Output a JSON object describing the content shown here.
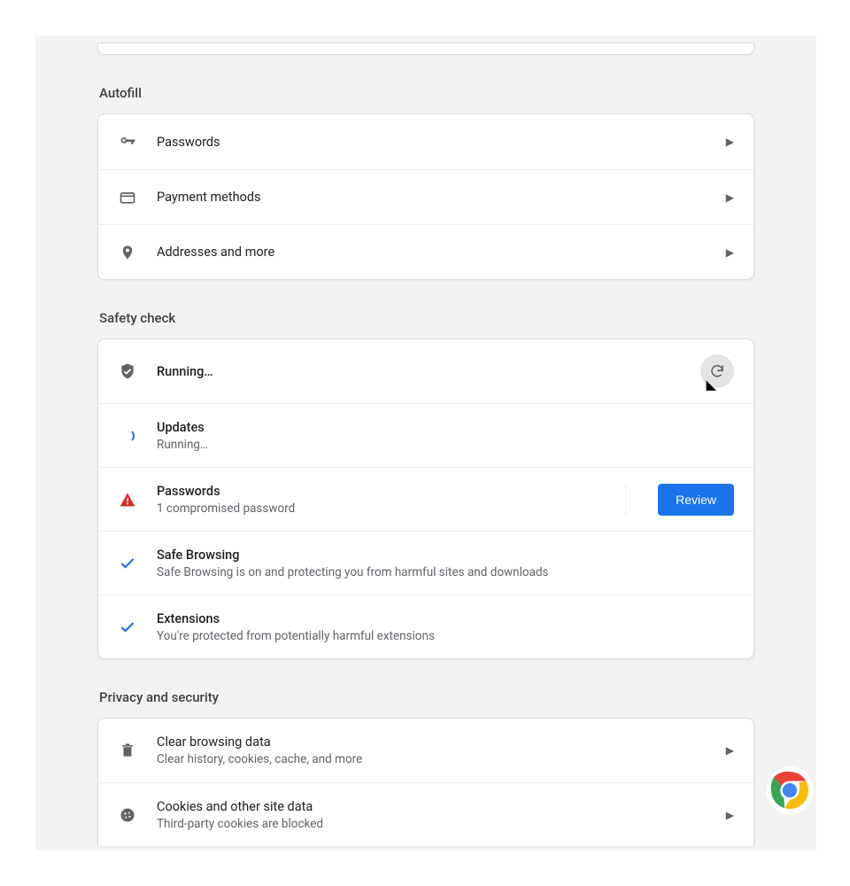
{
  "sections": {
    "autofill": {
      "title": "Autofill",
      "items": {
        "passwords": "Passwords",
        "payment": "Payment methods",
        "addresses": "Addresses and more"
      }
    },
    "safety": {
      "title": "Safety check",
      "status": {
        "label": "Running…"
      },
      "updates": {
        "title": "Updates",
        "sub": "Running…"
      },
      "passwords": {
        "title": "Passwords",
        "sub": "1 compromised password",
        "action": "Review"
      },
      "safeBrowsing": {
        "title": "Safe Browsing",
        "sub": "Safe Browsing is on and protecting you from harmful sites and downloads"
      },
      "extensions": {
        "title": "Extensions",
        "sub": "You're protected from potentially harmful extensions"
      }
    },
    "privacy": {
      "title": "Privacy and security",
      "clear": {
        "title": "Clear browsing data",
        "sub": "Clear history, cookies, cache, and more"
      },
      "cookies": {
        "title": "Cookies and other site data",
        "sub": "Third-party cookies are blocked"
      }
    }
  }
}
